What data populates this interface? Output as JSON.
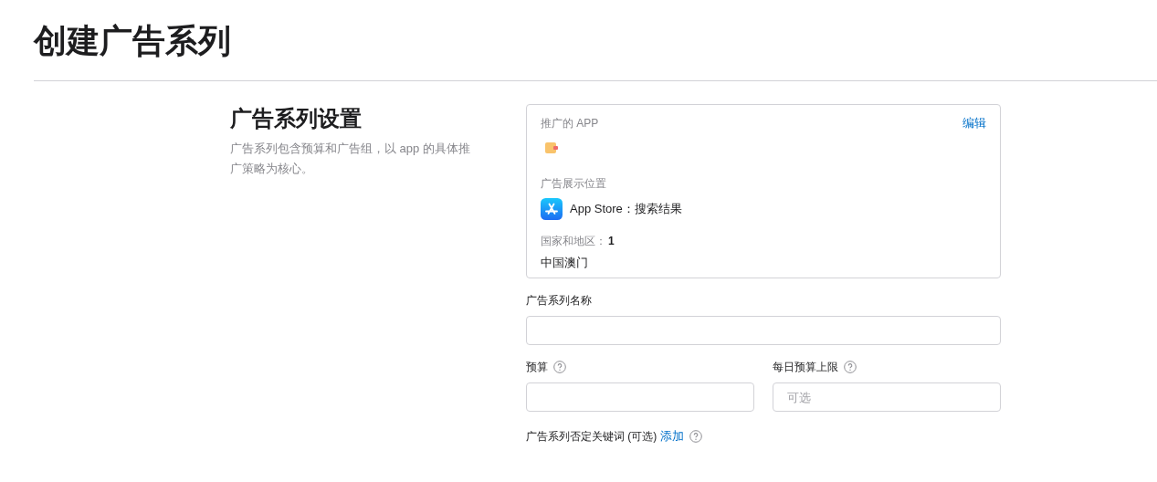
{
  "page_title": "创建广告系列",
  "section": {
    "title": "广告系列设置",
    "description": "广告系列包含预算和广告组，以 app 的具体推广策略为核心。"
  },
  "summary_card": {
    "promoted_app_label": "推广的 APP",
    "edit_link": "编辑",
    "placement_label": "广告展示位置",
    "placement": "App Store：搜索结果",
    "regions_label": "国家和地区：",
    "regions_count": "1",
    "regions": "中国澳门"
  },
  "fields": [
    {
      "kind": "full",
      "label": "广告系列名称",
      "help": false
    },
    {
      "kind": "half",
      "label": "预算",
      "help": true
    },
    {
      "kind": "half",
      "label": "每日预算上限",
      "help": true,
      "placeholder": "可选"
    }
  ],
  "negative_keywords": {
    "label": "广告系列否定关键词 (可选)",
    "link": "添加",
    "help": true
  }
}
